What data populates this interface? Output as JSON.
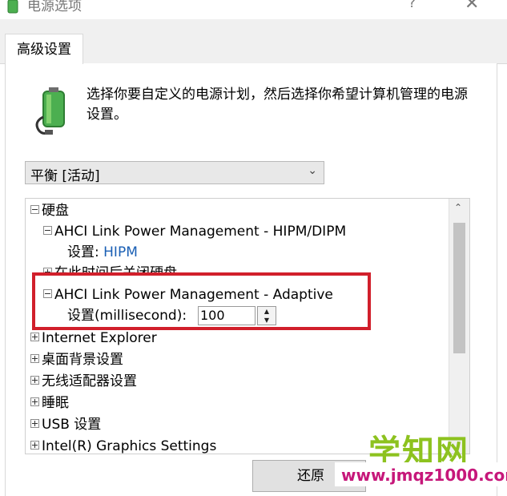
{
  "window": {
    "title": "电源选项",
    "help_glyph": "?",
    "close_glyph": "✕"
  },
  "tab": {
    "label": "高级设置"
  },
  "description": "选择你要自定义的电源计划，然后选择你希望计算机管理的电源设置。",
  "plan_select": {
    "value": "平衡 [活动]"
  },
  "tree": {
    "hard_disk": "硬盘",
    "hipm": "AHCI Link Power Management - HIPM/DIPM",
    "hipm_setting_label": "设置:",
    "hipm_setting_value": "HIPM",
    "turn_off_disk": "在此时间后关闭硬盘",
    "adaptive": "AHCI Link Power Management - Adaptive",
    "adaptive_setting_label": "设置(millisecond):",
    "adaptive_setting_value": "100",
    "internet_explorer": "Internet Explorer",
    "desktop_bg": "桌面背景设置",
    "wireless": "无线适配器设置",
    "sleep": "睡眠",
    "usb": "USB 设置",
    "intel_graphics": "Intel(R) Graphics Settings"
  },
  "buttons": {
    "restore": "还原"
  },
  "watermark": {
    "brand": "学知网",
    "url": "www.jmqz1000.com"
  },
  "colors": {
    "highlight": "#d11f2b",
    "link_blue": "#1a5fb4",
    "wm_green": "#8dc21f",
    "wm_magenta": "#c6177a"
  },
  "icons": {
    "app": "power-battery-icon",
    "large": "battery-plug-icon"
  }
}
